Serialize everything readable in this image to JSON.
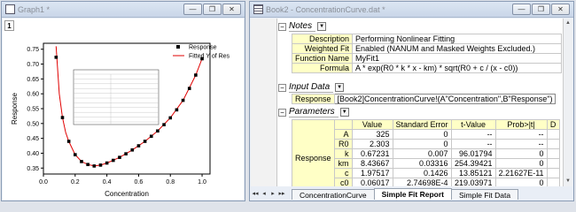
{
  "graph_window": {
    "title": "Graph1 *",
    "layer_number": "1",
    "ctrl": {
      "min": "—",
      "max": "❐",
      "close": "✕"
    }
  },
  "chart_data": {
    "type": "scatter",
    "xlabel": "Concentration",
    "ylabel": "Response",
    "xlim": [
      0.0,
      1.05
    ],
    "ylim": [
      0.33,
      0.77
    ],
    "xticks": [
      0.0,
      0.2,
      0.4,
      0.6,
      0.8,
      1.0
    ],
    "yticks": [
      0.35,
      0.4,
      0.45,
      0.5,
      0.55,
      0.6,
      0.65,
      0.7,
      0.75
    ],
    "legend": [
      "Response",
      "Fitted Y of Res"
    ],
    "legend_position": "top-right",
    "series": [
      {
        "name": "Response",
        "marker": "square",
        "color": "#000000",
        "x": [
          0.08,
          0.12,
          0.16,
          0.2,
          0.24,
          0.28,
          0.32,
          0.36,
          0.4,
          0.44,
          0.48,
          0.52,
          0.56,
          0.6,
          0.64,
          0.68,
          0.72,
          0.76,
          0.8,
          0.84,
          0.88,
          0.92,
          0.96,
          1.0
        ],
        "y": [
          0.723,
          0.52,
          0.44,
          0.395,
          0.372,
          0.362,
          0.357,
          0.36,
          0.367,
          0.376,
          0.386,
          0.398,
          0.411,
          0.425,
          0.44,
          0.457,
          0.475,
          0.496,
          0.519,
          0.546,
          0.578,
          0.618,
          0.663,
          0.718
        ]
      },
      {
        "name": "Fitted Y of Res",
        "line": true,
        "color": "#e00000",
        "x": [
          0.08,
          0.1,
          0.12,
          0.14,
          0.16,
          0.2,
          0.24,
          0.28,
          0.32,
          0.36,
          0.4,
          0.48,
          0.56,
          0.64,
          0.72,
          0.8,
          0.88,
          0.96,
          1.0
        ],
        "y": [
          0.76,
          0.6,
          0.52,
          0.47,
          0.44,
          0.395,
          0.372,
          0.362,
          0.357,
          0.36,
          0.367,
          0.386,
          0.411,
          0.44,
          0.475,
          0.519,
          0.578,
          0.663,
          0.718
        ]
      }
    ],
    "inset_table_note": "small inset fit-result table, text unreadable"
  },
  "book_window": {
    "title": "Book2 - ConcentrationCurve.dat *",
    "ctrl": {
      "min": "—",
      "max": "❐",
      "close": "✕"
    },
    "notes": {
      "section_label": "Notes",
      "rows": [
        {
          "label": "Description",
          "value": "Performing Nonlinear Fitting"
        },
        {
          "label": "Weighted Fit",
          "value": "Enabled (NANUM and Masked Weights Excluded.)"
        },
        {
          "label": "Function Name",
          "value": "MyFit1"
        },
        {
          "label": "Formula",
          "value": "A * exp(R0 * k * x - km) * sqrt(R0 + c / (x - c0))"
        }
      ]
    },
    "input_data": {
      "section_label": "Input Data",
      "label": "Response",
      "value": "[Book2]ConcentrationCurve!(A\"Concentration\",B\"Response\")"
    },
    "parameters": {
      "section_label": "Parameters",
      "group_label": "Response",
      "columns": [
        "",
        "Value",
        "Standard Error",
        "t-Value",
        "Prob>|t|",
        "D"
      ],
      "rows": [
        [
          "A",
          "325",
          "0",
          "--",
          "--",
          ""
        ],
        [
          "R0",
          "2.303",
          "0",
          "--",
          "--",
          ""
        ],
        [
          "k",
          "0.67231",
          "0.007",
          "96.01794",
          "0",
          ""
        ],
        [
          "km",
          "8.43667",
          "0.03316",
          "254.39421",
          "0",
          ""
        ],
        [
          "c",
          "1.97517",
          "0.1426",
          "13.85121",
          "2.21627E-11",
          ""
        ],
        [
          "c0",
          "0.06017",
          "2.74698E-4",
          "219.03971",
          "0",
          ""
        ]
      ]
    },
    "sheet_tabs": [
      {
        "label": "ConcentrationCurve",
        "active": false
      },
      {
        "label": "Simple Fit Report",
        "active": true
      },
      {
        "label": "Simple Fit Data",
        "active": false
      }
    ],
    "tab_nav": [
      "◂◂",
      "◂",
      "▸",
      "▸▸"
    ]
  }
}
